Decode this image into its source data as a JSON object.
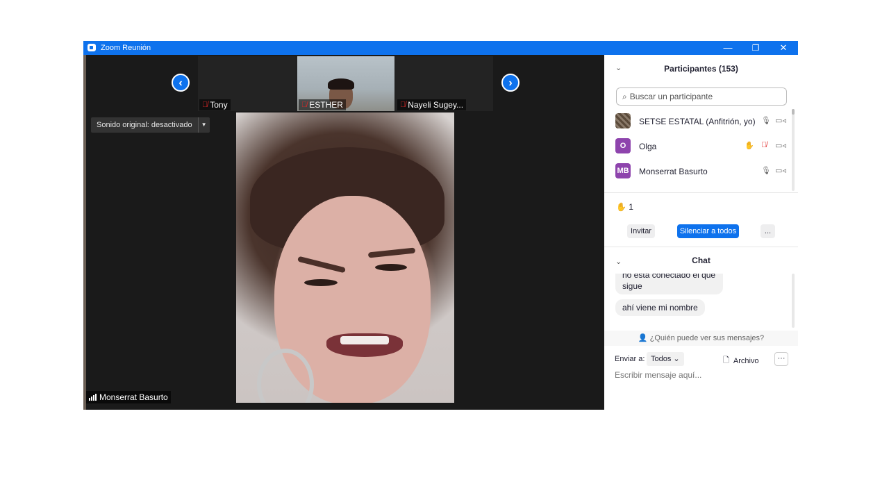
{
  "window": {
    "title": "Zoom Reunión",
    "controls": {
      "minimize": "—",
      "restore": "❐",
      "close": "✕"
    }
  },
  "video": {
    "thumbnails": [
      {
        "name": "Tony"
      },
      {
        "name": "ESTHER"
      },
      {
        "name": "Nayeli Sugey..."
      }
    ],
    "prev_arrow": "‹",
    "next_arrow": "›",
    "original_sound": {
      "label": "Sonido original: desactivado",
      "arrow": "▼"
    },
    "active_speaker": "Monserrat Basurto"
  },
  "participants": {
    "title": "Participantes (153)",
    "collapse_glyph": "⌄",
    "search_placeholder": "Buscar un participante",
    "list": [
      {
        "name": "SETSE ESTATAL (Anfitrión, yo)",
        "initials": "",
        "avatar_color": "#5a4a3a",
        "hand": "",
        "muted": false
      },
      {
        "name": "Olga",
        "initials": "O",
        "avatar_color": "#8e44ad",
        "hand": "✋",
        "muted": true
      },
      {
        "name": "Monserrat Basurto",
        "initials": "MB",
        "avatar_color": "#8e44ad",
        "hand": "",
        "muted": false
      }
    ],
    "raised_hands": {
      "icon": "✋",
      "count": "1"
    },
    "buttons": {
      "invite": "Invitar",
      "mute_all": "Silenciar a todos",
      "more": "..."
    }
  },
  "chat": {
    "title": "Chat",
    "messages": [
      "no está conectado el que sigue",
      "ahí viene mi nombre"
    ],
    "who_can_see": "¿Quién puede ver sus mensajes?",
    "send_to_label": "Enviar a:",
    "send_to_value": "Todos",
    "file_label": "Archivo",
    "more": "···",
    "input_placeholder": "Escribir mensaje aquí..."
  },
  "colors": {
    "accent": "#0e72ed",
    "muted_red": "#e02828",
    "hand_yellow": "#f5b800"
  }
}
